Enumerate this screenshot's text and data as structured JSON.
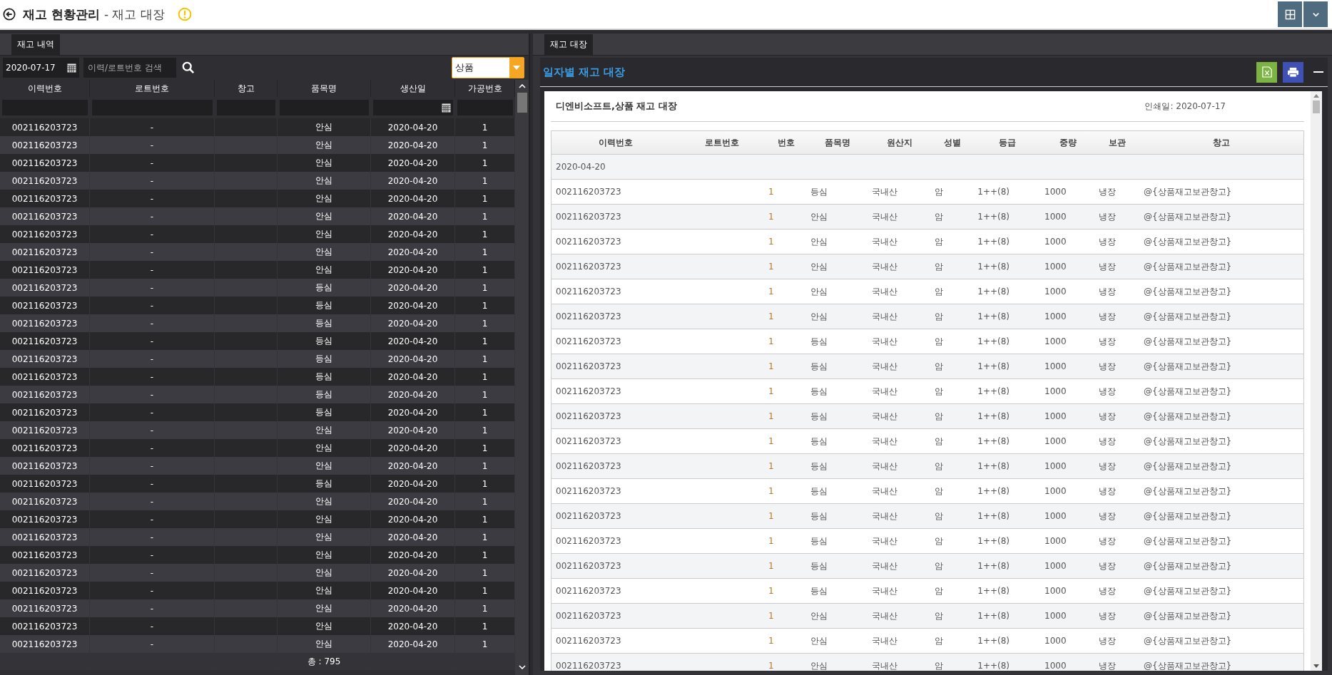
{
  "header": {
    "title": "재고 현황관리",
    "subtitle": "- 재고 대장"
  },
  "left_panel": {
    "tab": "재고 내역",
    "date": "2020-07-17",
    "search": {
      "placeholder": "이력/로트번호 검색"
    },
    "category": "상품",
    "columns": [
      "이력번호",
      "로트번호",
      "창고",
      "품목명",
      "생산일",
      "가공번호"
    ],
    "rows": [
      {
        "id": "002116203723",
        "lot": "-",
        "product": "안심",
        "date": "2020-04-20",
        "process_no": "1"
      },
      {
        "id": "002116203723",
        "lot": "-",
        "product": "안심",
        "date": "2020-04-20",
        "process_no": "1"
      },
      {
        "id": "002116203723",
        "lot": "-",
        "product": "안심",
        "date": "2020-04-20",
        "process_no": "1"
      },
      {
        "id": "002116203723",
        "lot": "-",
        "product": "안심",
        "date": "2020-04-20",
        "process_no": "1"
      },
      {
        "id": "002116203723",
        "lot": "-",
        "product": "안심",
        "date": "2020-04-20",
        "process_no": "1"
      },
      {
        "id": "002116203723",
        "lot": "-",
        "product": "안심",
        "date": "2020-04-20",
        "process_no": "1"
      },
      {
        "id": "002116203723",
        "lot": "-",
        "product": "안심",
        "date": "2020-04-20",
        "process_no": "1"
      },
      {
        "id": "002116203723",
        "lot": "-",
        "product": "안심",
        "date": "2020-04-20",
        "process_no": "1"
      },
      {
        "id": "002116203723",
        "lot": "-",
        "product": "안심",
        "date": "2020-04-20",
        "process_no": "1"
      },
      {
        "id": "002116203723",
        "lot": "-",
        "product": "등심",
        "date": "2020-04-20",
        "process_no": "1"
      },
      {
        "id": "002116203723",
        "lot": "-",
        "product": "등심",
        "date": "2020-04-20",
        "process_no": "1"
      },
      {
        "id": "002116203723",
        "lot": "-",
        "product": "등심",
        "date": "2020-04-20",
        "process_no": "1"
      },
      {
        "id": "002116203723",
        "lot": "-",
        "product": "등심",
        "date": "2020-04-20",
        "process_no": "1"
      },
      {
        "id": "002116203723",
        "lot": "-",
        "product": "등심",
        "date": "2020-04-20",
        "process_no": "1"
      },
      {
        "id": "002116203723",
        "lot": "-",
        "product": "등심",
        "date": "2020-04-20",
        "process_no": "1"
      },
      {
        "id": "002116203723",
        "lot": "-",
        "product": "등심",
        "date": "2020-04-20",
        "process_no": "1"
      },
      {
        "id": "002116203723",
        "lot": "-",
        "product": "등심",
        "date": "2020-04-20",
        "process_no": "1"
      },
      {
        "id": "002116203723",
        "lot": "-",
        "product": "안심",
        "date": "2020-04-20",
        "process_no": "1"
      },
      {
        "id": "002116203723",
        "lot": "-",
        "product": "안심",
        "date": "2020-04-20",
        "process_no": "1"
      },
      {
        "id": "002116203723",
        "lot": "-",
        "product": "안심",
        "date": "2020-04-20",
        "process_no": "1"
      },
      {
        "id": "002116203723",
        "lot": "-",
        "product": "등심",
        "date": "2020-04-20",
        "process_no": "1"
      },
      {
        "id": "002116203723",
        "lot": "-",
        "product": "안심",
        "date": "2020-04-20",
        "process_no": "1"
      },
      {
        "id": "002116203723",
        "lot": "-",
        "product": "안심",
        "date": "2020-04-20",
        "process_no": "1"
      },
      {
        "id": "002116203723",
        "lot": "-",
        "product": "안심",
        "date": "2020-04-20",
        "process_no": "1"
      },
      {
        "id": "002116203723",
        "lot": "-",
        "product": "안심",
        "date": "2020-04-20",
        "process_no": "1"
      },
      {
        "id": "002116203723",
        "lot": "-",
        "product": "안심",
        "date": "2020-04-20",
        "process_no": "1"
      },
      {
        "id": "002116203723",
        "lot": "-",
        "product": "안심",
        "date": "2020-04-20",
        "process_no": "1"
      },
      {
        "id": "002116203723",
        "lot": "-",
        "product": "안심",
        "date": "2020-04-20",
        "process_no": "1"
      },
      {
        "id": "002116203723",
        "lot": "-",
        "product": "안심",
        "date": "2020-04-20",
        "process_no": "1"
      },
      {
        "id": "002116203723",
        "lot": "-",
        "product": "안심",
        "date": "2020-04-20",
        "process_no": "1"
      }
    ],
    "footer": "총 : 795"
  },
  "right_panel": {
    "tab": "재고 대장",
    "title": "일자별 재고 대장",
    "report": {
      "company_title": "디엔비소프트,상품 재고 대장",
      "print_date": "인쇄일: 2020-07-17",
      "columns": [
        "이력번호",
        "로트번호",
        "번호",
        "품목명",
        "원산지",
        "성별",
        "등급",
        "중량",
        "보관",
        "창고"
      ],
      "groups": [
        {
          "date": "2020-04-20",
          "rows": [
            {
              "id": "002116203723",
              "no": "1",
              "product": "등심",
              "origin": "국내산",
              "sex": "암",
              "grade": "1++(8)",
              "weight": "1000",
              "storage": "냉장",
              "warehouse": "@{상품재고보관창고}"
            },
            {
              "id": "002116203723",
              "no": "1",
              "product": "안심",
              "origin": "국내산",
              "sex": "암",
              "grade": "1++(8)",
              "weight": "1000",
              "storage": "냉장",
              "warehouse": "@{상품재고보관창고}"
            },
            {
              "id": "002116203723",
              "no": "1",
              "product": "안심",
              "origin": "국내산",
              "sex": "암",
              "grade": "1++(8)",
              "weight": "1000",
              "storage": "냉장",
              "warehouse": "@{상품재고보관창고}"
            },
            {
              "id": "002116203723",
              "no": "1",
              "product": "안심",
              "origin": "국내산",
              "sex": "암",
              "grade": "1++(8)",
              "weight": "1000",
              "storage": "냉장",
              "warehouse": "@{상품재고보관창고}"
            },
            {
              "id": "002116203723",
              "no": "1",
              "product": "안심",
              "origin": "국내산",
              "sex": "암",
              "grade": "1++(8)",
              "weight": "1000",
              "storage": "냉장",
              "warehouse": "@{상품재고보관창고}"
            },
            {
              "id": "002116203723",
              "no": "1",
              "product": "안심",
              "origin": "국내산",
              "sex": "암",
              "grade": "1++(8)",
              "weight": "1000",
              "storage": "냉장",
              "warehouse": "@{상품재고보관창고}"
            },
            {
              "id": "002116203723",
              "no": "1",
              "product": "등심",
              "origin": "국내산",
              "sex": "암",
              "grade": "1++(8)",
              "weight": "1000",
              "storage": "냉장",
              "warehouse": "@{상품재고보관창고}"
            },
            {
              "id": "002116203723",
              "no": "1",
              "product": "등심",
              "origin": "국내산",
              "sex": "암",
              "grade": "1++(8)",
              "weight": "1000",
              "storage": "냉장",
              "warehouse": "@{상품재고보관창고}"
            },
            {
              "id": "002116203723",
              "no": "1",
              "product": "등심",
              "origin": "국내산",
              "sex": "암",
              "grade": "1++(8)",
              "weight": "1000",
              "storage": "냉장",
              "warehouse": "@{상품재고보관창고}"
            },
            {
              "id": "002116203723",
              "no": "1",
              "product": "등심",
              "origin": "국내산",
              "sex": "암",
              "grade": "1++(8)",
              "weight": "1000",
              "storage": "냉장",
              "warehouse": "@{상품재고보관창고}"
            },
            {
              "id": "002116203723",
              "no": "1",
              "product": "등심",
              "origin": "국내산",
              "sex": "암",
              "grade": "1++(8)",
              "weight": "1000",
              "storage": "냉장",
              "warehouse": "@{상품재고보관창고}"
            },
            {
              "id": "002116203723",
              "no": "1",
              "product": "등심",
              "origin": "국내산",
              "sex": "암",
              "grade": "1++(8)",
              "weight": "1000",
              "storage": "냉장",
              "warehouse": "@{상품재고보관창고}"
            },
            {
              "id": "002116203723",
              "no": "1",
              "product": "등심",
              "origin": "국내산",
              "sex": "암",
              "grade": "1++(8)",
              "weight": "1000",
              "storage": "냉장",
              "warehouse": "@{상품재고보관창고}"
            },
            {
              "id": "002116203723",
              "no": "1",
              "product": "등심",
              "origin": "국내산",
              "sex": "암",
              "grade": "1++(8)",
              "weight": "1000",
              "storage": "냉장",
              "warehouse": "@{상품재고보관창고}"
            },
            {
              "id": "002116203723",
              "no": "1",
              "product": "등심",
              "origin": "국내산",
              "sex": "암",
              "grade": "1++(8)",
              "weight": "1000",
              "storage": "냉장",
              "warehouse": "@{상품재고보관창고}"
            },
            {
              "id": "002116203723",
              "no": "1",
              "product": "등심",
              "origin": "국내산",
              "sex": "암",
              "grade": "1++(8)",
              "weight": "1000",
              "storage": "냉장",
              "warehouse": "@{상품재고보관창고}"
            },
            {
              "id": "002116203723",
              "no": "1",
              "product": "등심",
              "origin": "국내산",
              "sex": "암",
              "grade": "1++(8)",
              "weight": "1000",
              "storage": "냉장",
              "warehouse": "@{상품재고보관창고}"
            },
            {
              "id": "002116203723",
              "no": "1",
              "product": "안심",
              "origin": "국내산",
              "sex": "암",
              "grade": "1++(8)",
              "weight": "1000",
              "storage": "냉장",
              "warehouse": "@{상품재고보관창고}"
            },
            {
              "id": "002116203723",
              "no": "1",
              "product": "안심",
              "origin": "국내산",
              "sex": "암",
              "grade": "1++(8)",
              "weight": "1000",
              "storage": "냉장",
              "warehouse": "@{상품재고보관창고}"
            },
            {
              "id": "002116203723",
              "no": "1",
              "product": "안심",
              "origin": "국내산",
              "sex": "암",
              "grade": "1++(8)",
              "weight": "1000",
              "storage": "냉장",
              "warehouse": "@{상품재고보관창고}"
            }
          ]
        }
      ]
    }
  }
}
